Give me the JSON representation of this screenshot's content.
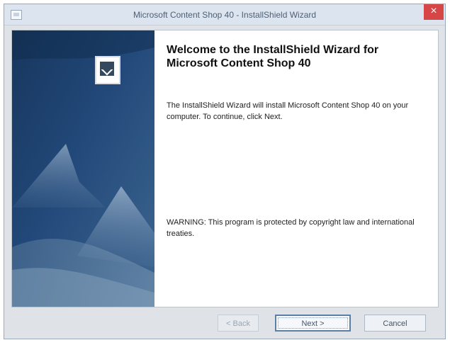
{
  "window": {
    "title": "Microsoft Content Shop 40 - InstallShield Wizard",
    "close_glyph": "×"
  },
  "wizard": {
    "heading": "Welcome to the InstallShield Wizard for Microsoft Content Shop 40",
    "intro": "The InstallShield Wizard will install Microsoft Content Shop 40 on your computer. To continue, click Next.",
    "warning": "WARNING: This program is protected by copyright law and international treaties."
  },
  "buttons": {
    "back": "< Back",
    "next": "Next >",
    "cancel": "Cancel"
  },
  "colors": {
    "side_dark": "#1e3a61",
    "side_mid": "#2b5280",
    "side_light": "#4f7298",
    "close_red": "#d74646"
  },
  "icons": {
    "app": "installer-window-icon",
    "logo": "product-logo-icon",
    "close": "close-icon"
  }
}
